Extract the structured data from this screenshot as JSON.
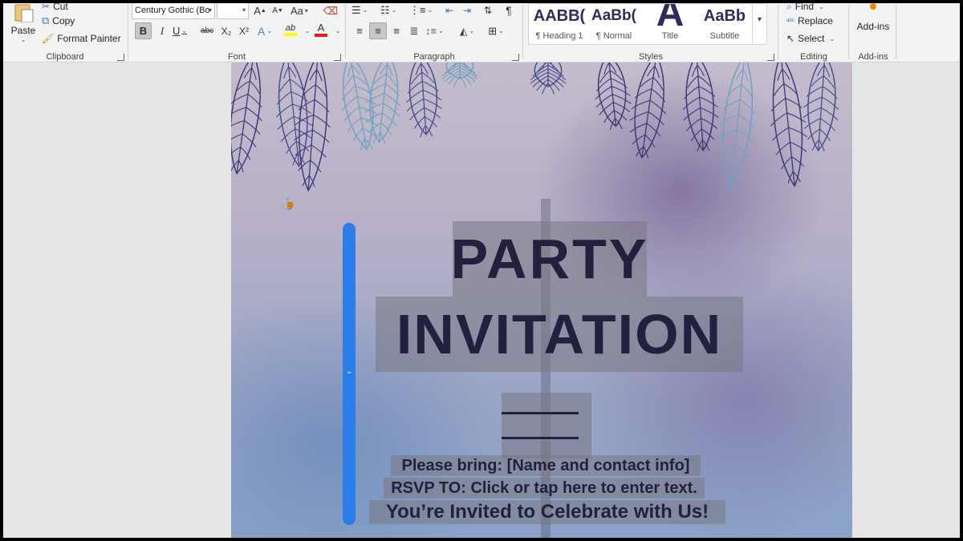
{
  "ribbon": {
    "clipboard": {
      "paste_label": "Paste",
      "cut_label": "Cut",
      "copy_label": "Copy",
      "format_painter_label": "Format Painter",
      "group_label": "Clipboard"
    },
    "font": {
      "font_name_value": "Century Gothic (Bo",
      "font_size_value": "",
      "grow_label": "A",
      "shrink_label": "A",
      "change_case_label": "Aa",
      "bold_label": "B",
      "italic_label": "I",
      "underline_label": "U",
      "strikethrough_label": "abc",
      "subscript_label": "X₂",
      "superscript_label": "X²",
      "text_effects_label": "A",
      "highlight_label": "ab",
      "font_color_label": "A",
      "group_label": "Font"
    },
    "paragraph": {
      "group_label": "Paragraph",
      "show_marks_label": "¶"
    },
    "styles": {
      "tiles": [
        {
          "sample": "AABB(",
          "name": "¶ Heading 1"
        },
        {
          "sample": "AaBb(",
          "name": "¶ Normal"
        },
        {
          "sample": "A",
          "name": "Title"
        },
        {
          "sample": "AaBb",
          "name": "Subtitle"
        }
      ],
      "group_label": "Styles"
    },
    "editing": {
      "find_label": "Find",
      "replace_label": "Replace",
      "select_label": "Select",
      "group_label": "Editing"
    },
    "addins": {
      "button_label": "Add-ins",
      "group_label": "Add-ins"
    }
  },
  "document": {
    "title_line_1": "PARTY",
    "title_line_2": "INVITATION",
    "bring_text": "Please bring: [Name and contact info]",
    "rsvp_text": "RSVP TO: Click or tap here to enter text.",
    "invited_text": "You’re Invited to Celebrate with Us!"
  },
  "colors": {
    "accent_selection": "#2b7de9",
    "title_text": "#23203f",
    "ribbon_bg": "#f3f3f3"
  }
}
